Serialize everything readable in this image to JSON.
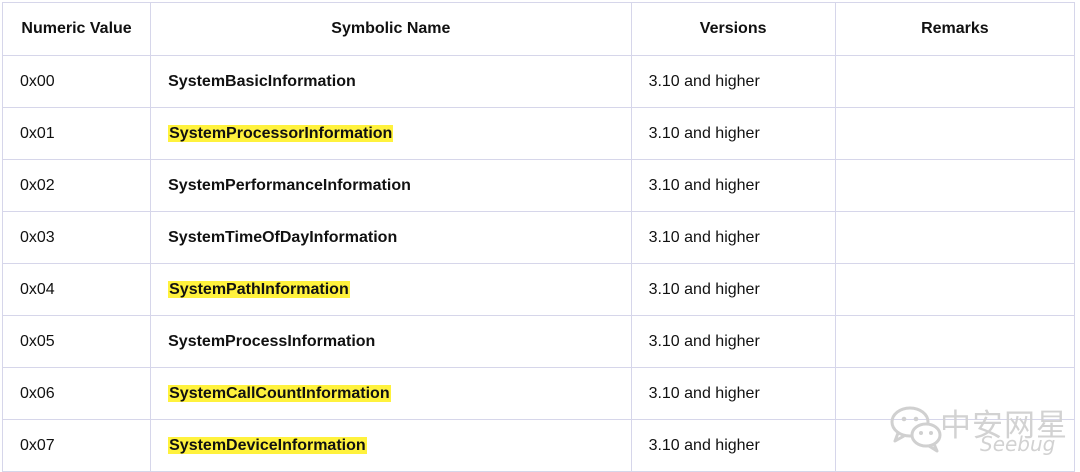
{
  "table": {
    "headers": [
      "Numeric Value",
      "Symbolic Name",
      "Versions",
      "Remarks"
    ],
    "rows": [
      {
        "value": "0x00",
        "name": "SystemBasicInformation",
        "version": "3.10 and higher",
        "remarks": "",
        "highlighted": false
      },
      {
        "value": "0x01",
        "name": "SystemProcessorInformation",
        "version": "3.10 and higher",
        "remarks": "",
        "highlighted": true
      },
      {
        "value": "0x02",
        "name": "SystemPerformanceInformation",
        "version": "3.10 and higher",
        "remarks": "",
        "highlighted": false
      },
      {
        "value": "0x03",
        "name": "SystemTimeOfDayInformation",
        "version": "3.10 and higher",
        "remarks": "",
        "highlighted": false
      },
      {
        "value": "0x04",
        "name": "SystemPathInformation",
        "version": "3.10 and higher",
        "remarks": "",
        "highlighted": true
      },
      {
        "value": "0x05",
        "name": "SystemProcessInformation",
        "version": "3.10 and higher",
        "remarks": "",
        "highlighted": false
      },
      {
        "value": "0x06",
        "name": "SystemCallCountInformation",
        "version": "3.10 and higher",
        "remarks": "",
        "highlighted": true
      },
      {
        "value": "0x07",
        "name": "SystemDeviceInformation",
        "version": "3.10 and higher",
        "remarks": "",
        "highlighted": true
      }
    ]
  },
  "watermark": {
    "cn_text": "中安网星",
    "en_text": "Seebug",
    "icon": "wechat-icon"
  },
  "colors": {
    "highlight": "#fff23d",
    "grid": "#d6d6ea"
  }
}
